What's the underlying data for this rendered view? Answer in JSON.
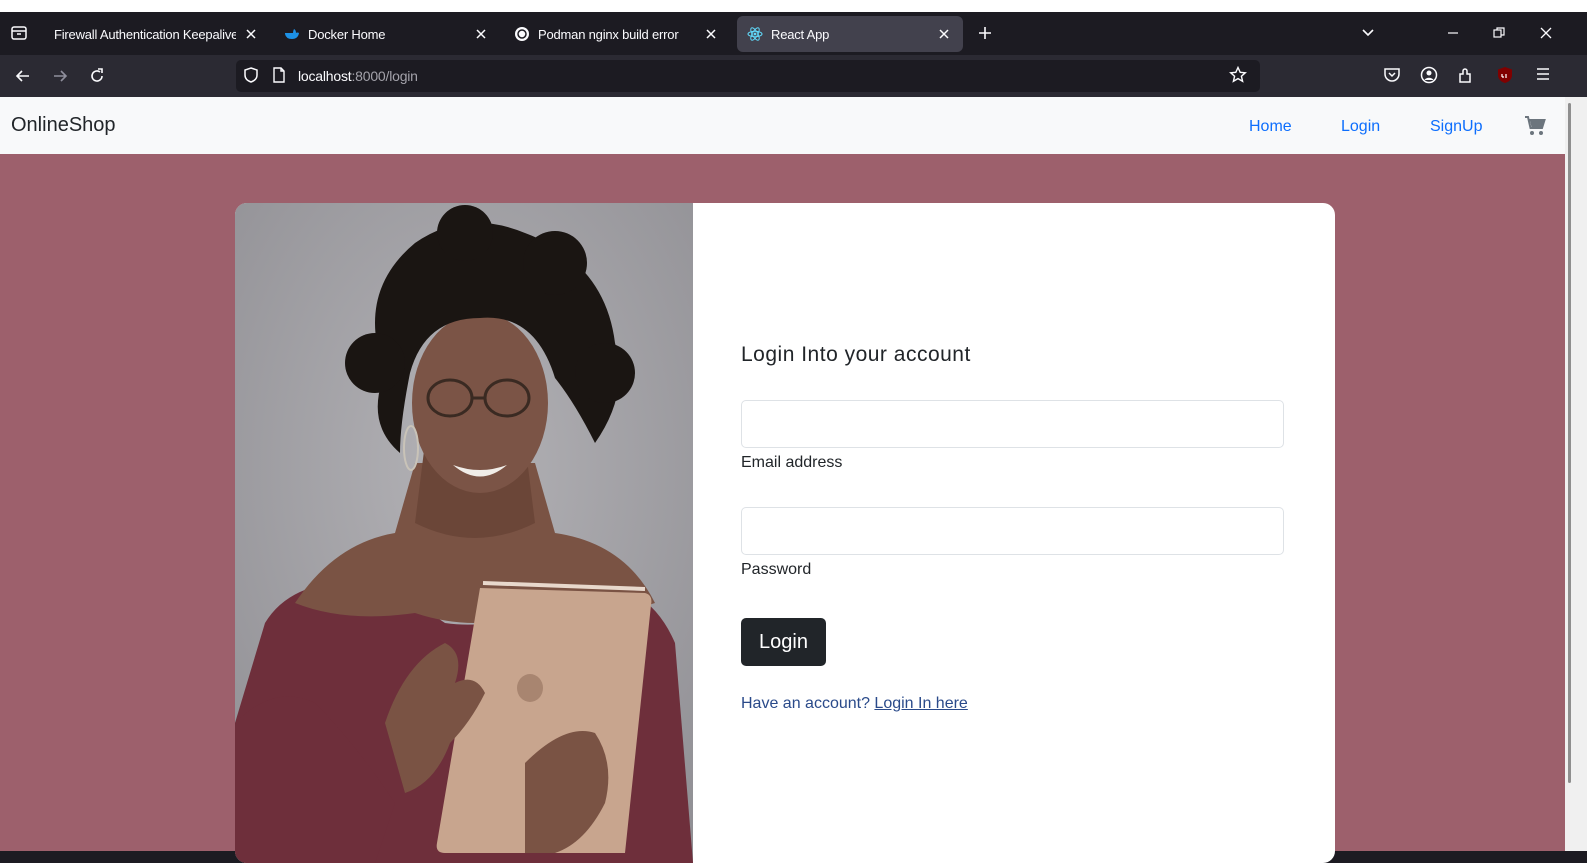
{
  "browser": {
    "tabs": [
      {
        "title": "Firewall Authentication Keepalive W",
        "active": false
      },
      {
        "title": "Docker Home",
        "active": false
      },
      {
        "title": "Podman nginx build error",
        "active": false
      },
      {
        "title": "React App",
        "active": true
      }
    ],
    "url": {
      "host": "localhost",
      "path": ":8000/login"
    }
  },
  "site": {
    "brand": "OnlineShop",
    "nav": [
      "Home",
      "Login",
      "SignUp"
    ]
  },
  "login": {
    "heading": "Login Into your account",
    "email_label": "Email address",
    "email_value": "",
    "password_label": "Password",
    "password_value": "",
    "button_label": "Login",
    "account_prompt": "Have an account? ",
    "account_link": "Login In here"
  },
  "colors": {
    "page_background": "#9d606c",
    "button": "#212529",
    "nav_link": "#0d6efd"
  }
}
